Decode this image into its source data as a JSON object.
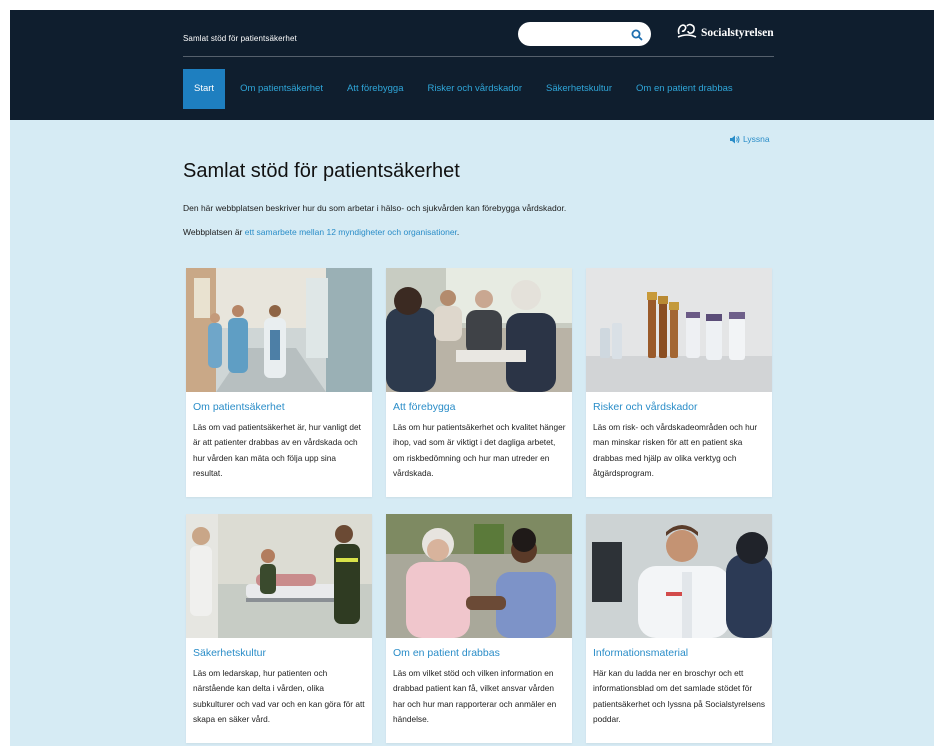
{
  "header": {
    "site_name": "Samlat stöd för patientsäkerhet",
    "search": {
      "placeholder": "",
      "icon": "search-icon"
    },
    "logo": {
      "text": "Socialstyrelsen",
      "icon": "socialstyrelsen-logo-icon"
    }
  },
  "nav": {
    "items": [
      {
        "label": "Start",
        "active": true
      },
      {
        "label": "Om patientsäkerhet",
        "active": false
      },
      {
        "label": "Att förebygga",
        "active": false
      },
      {
        "label": "Risker och vårdskador",
        "active": false
      },
      {
        "label": "Säkerhetskultur",
        "active": false
      },
      {
        "label": "Om en patient drabbas",
        "active": false
      }
    ]
  },
  "listen": {
    "label": "Lyssna",
    "icon": "speaker-icon"
  },
  "main": {
    "title": "Samlat stöd för patientsäkerhet",
    "intro": "Den här webbplatsen beskriver hur du som arbetar i hälso- och sjukvården kan förebygga vårdskador.",
    "partners_prefix": "Webbplatsen är ",
    "partners_link": "ett samarbete mellan 12 myndigheter och organisationer",
    "partners_suffix": "."
  },
  "cards": [
    {
      "title": "Om patientsäkerhet",
      "description": "Läs om vad patientsäkerhet är, hur vanligt det är att patienter drabbas av en vårdskada och hur vården kan mäta och följa upp sina resultat.",
      "image": "hospital-corridor-staff-photo"
    },
    {
      "title": "Att förebygga",
      "description": "Läs om hur patientsäkerhet och kvalitet hänger ihop, vad som är viktigt i det dagliga arbetet, om riskbedömning och hur man utreder en vårdskada.",
      "image": "care-meeting-photo"
    },
    {
      "title": "Risker och vårdskador",
      "description": "Läs om risk- och vårdskadeområden och hur man minskar risken för att en patient ska drabbas med hjälp av olika verktyg och åtgärdsprogram.",
      "image": "medicine-vials-photo"
    },
    {
      "title": "Säkerhetskultur",
      "description": "Läs om ledarskap, hur patienten och närstående kan delta i vården, olika subkulturer och vad var och en kan göra för att skapa en säker vård.",
      "image": "paramedics-stretcher-photo"
    },
    {
      "title": "Om en patient drabbas",
      "description": "Läs om vilket stöd och vilken information en drabbad patient kan få, vilket ansvar vården har och hur man rapporterar och anmäler en händelse.",
      "image": "elderly-patient-nurse-photo"
    },
    {
      "title": "Informationsmaterial",
      "description": "Här kan du ladda ner en broschyr och ett informationsblad om det samlade stödet för patientsäkerhet och lyssna på Socialstyrelsens poddar.",
      "image": "doctor-patient-photo"
    }
  ],
  "colors": {
    "header_bg": "#0f1e2e",
    "nav_link": "#2fa6d9",
    "nav_active_bg": "#1e7fc0",
    "page_bg": "#d6ebf4",
    "link": "#2a8dc8"
  }
}
